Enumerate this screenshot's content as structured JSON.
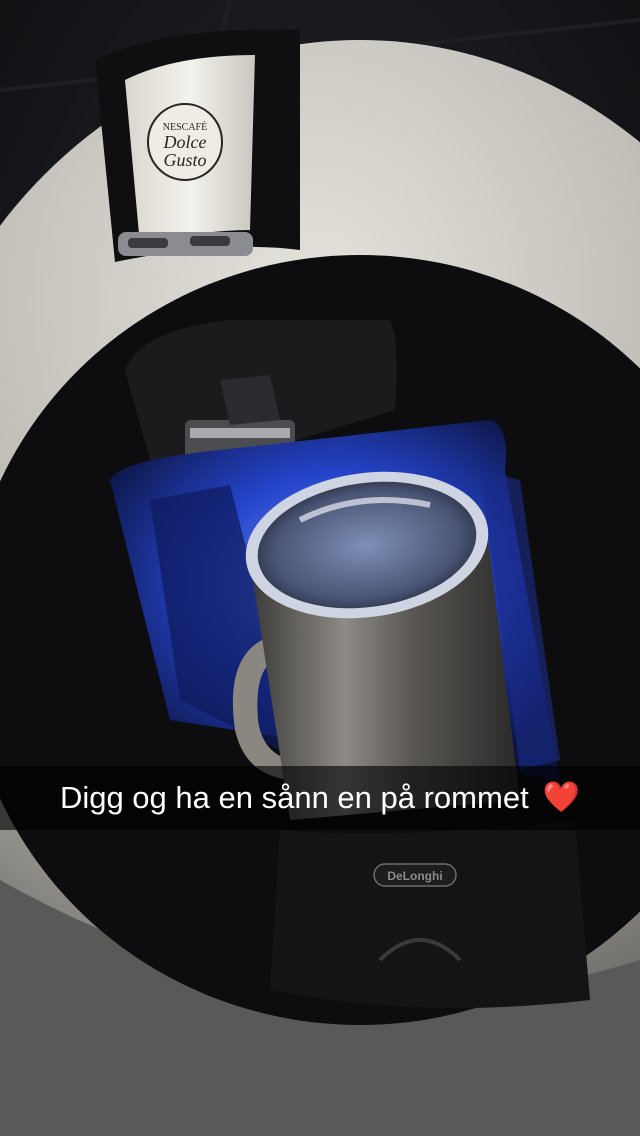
{
  "photo": {
    "description_icon": "coffee-machine-photo",
    "brand_label_top": [
      "NESCAFÉ",
      "Dolce",
      "Gusto"
    ],
    "brand_label_bottom": "DeLonghi",
    "accent_light": "#3d6cff"
  },
  "caption": {
    "text": "Digg og ha en sånn en på rommet",
    "emoji": "❤️"
  }
}
